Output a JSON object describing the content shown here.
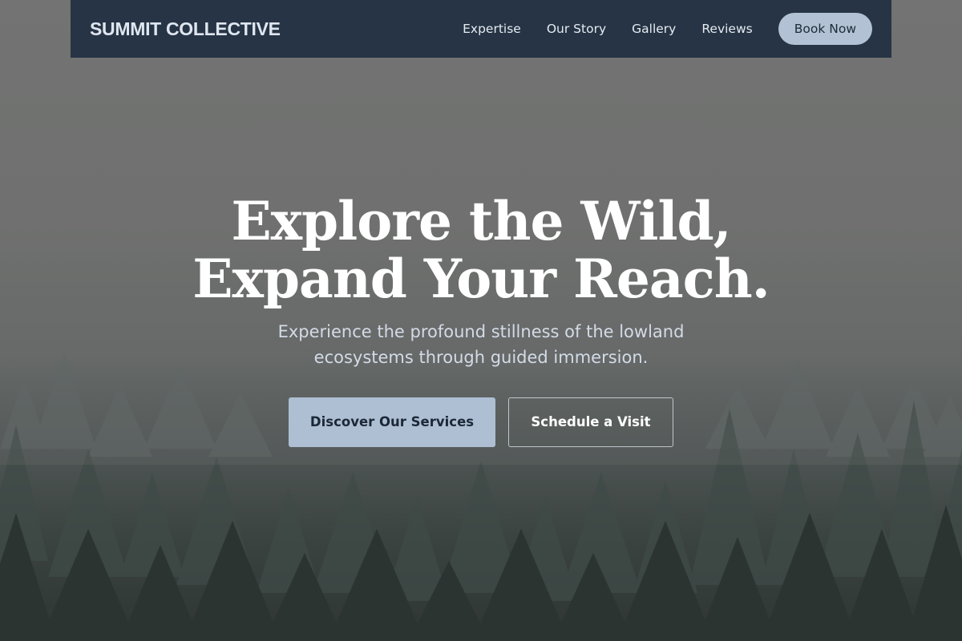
{
  "nav": {
    "brand": "SUMMIT COLLECTIVE",
    "links": [
      "Expertise",
      "Our Story",
      "Gallery",
      "Reviews"
    ],
    "cta": "Book Now"
  },
  "hero": {
    "headline_line1": "Explore the Wild,",
    "headline_line2": "Expand Your Reach.",
    "subhead_line1": "Experience the profound stillness of the lowland",
    "subhead_line2": "ecosystems through guided immersion.",
    "primary_cta": "Discover Our Services",
    "secondary_cta": "Schedule a Visit"
  },
  "colors": {
    "nav_bg": "#263445",
    "accent": "#aebfd3",
    "text_on_accent": "#1c2838"
  },
  "background": {
    "description": "misty evergreen forest photograph"
  }
}
